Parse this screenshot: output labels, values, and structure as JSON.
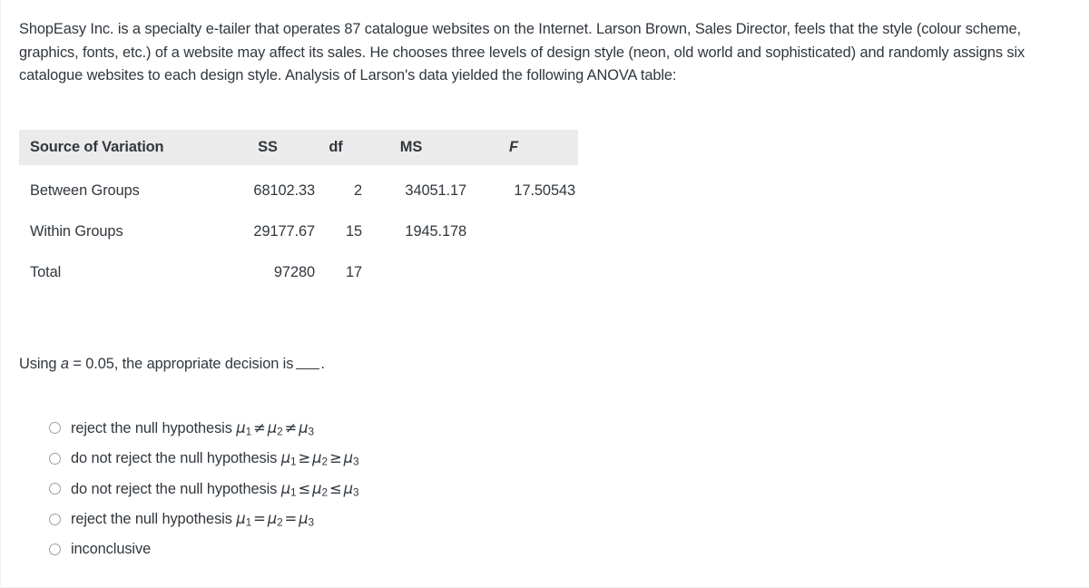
{
  "prompt": {
    "text": "ShopEasy Inc. is a specialty e-tailer that operates 87 catalogue websites on the Internet. Larson Brown, Sales Director, feels that the style (colour scheme, graphics, fonts, etc.) of a website may affect its sales. He chooses three levels of design style (neon, old world and sophisticated) and randomly assigns six catalogue websites to each design style. Analysis of Larson's data yielded the following ANOVA table:"
  },
  "anova_table": {
    "headers": {
      "source": "Source of Variation",
      "ss": "SS",
      "df": "df",
      "ms": "MS",
      "f": "F"
    },
    "rows": [
      {
        "source": "Between Groups",
        "ss": "68102.33",
        "df": "2",
        "ms": "34051.17",
        "f": "17.50543"
      },
      {
        "source": "Within Groups",
        "ss": "29177.67",
        "df": "15",
        "ms": "1945.178",
        "f": ""
      },
      {
        "source": "Total",
        "ss": "97280",
        "df": "17",
        "ms": "",
        "f": ""
      }
    ],
    "header_background": "#ebebeb"
  },
  "question": {
    "prefix": "Using ",
    "symbol": "a",
    "middle": " = 0.05, the appropriate decision is",
    "suffix": "."
  },
  "options": [
    {
      "decision": "reject the null hypothesis ",
      "mu1": "μ",
      "sub1": "1",
      "op1": "≠",
      "mu2": "μ",
      "sub2": "2",
      "op2": "≠",
      "mu3": "μ",
      "sub3": "3"
    },
    {
      "decision": "do not reject the null hypothesis ",
      "mu1": "μ",
      "sub1": "1",
      "op1": "≥",
      "mu2": "μ",
      "sub2": "2",
      "op2": "≥",
      "mu3": "μ",
      "sub3": "3"
    },
    {
      "decision": "do not reject the null hypothesis ",
      "mu1": "μ",
      "sub1": "1",
      "op1": "≤",
      "mu2": "μ",
      "sub2": "2",
      "op2": "≤",
      "mu3": "μ",
      "sub3": "3"
    },
    {
      "decision": "reject the null hypothesis ",
      "mu1": "μ",
      "sub1": "1",
      "op1": "=",
      "mu2": "μ",
      "sub2": "2",
      "op2": "=",
      "mu3": "μ",
      "sub3": "3"
    },
    {
      "decision": "inconclusive",
      "mu1": "",
      "sub1": "",
      "op1": "",
      "mu2": "",
      "sub2": "",
      "op2": "",
      "mu3": "",
      "sub3": ""
    }
  ],
  "colors": {
    "text": "#31373d",
    "header_band": "#ebebeb",
    "radio_border": "#9aa0a6",
    "page_background": "#ffffff"
  }
}
